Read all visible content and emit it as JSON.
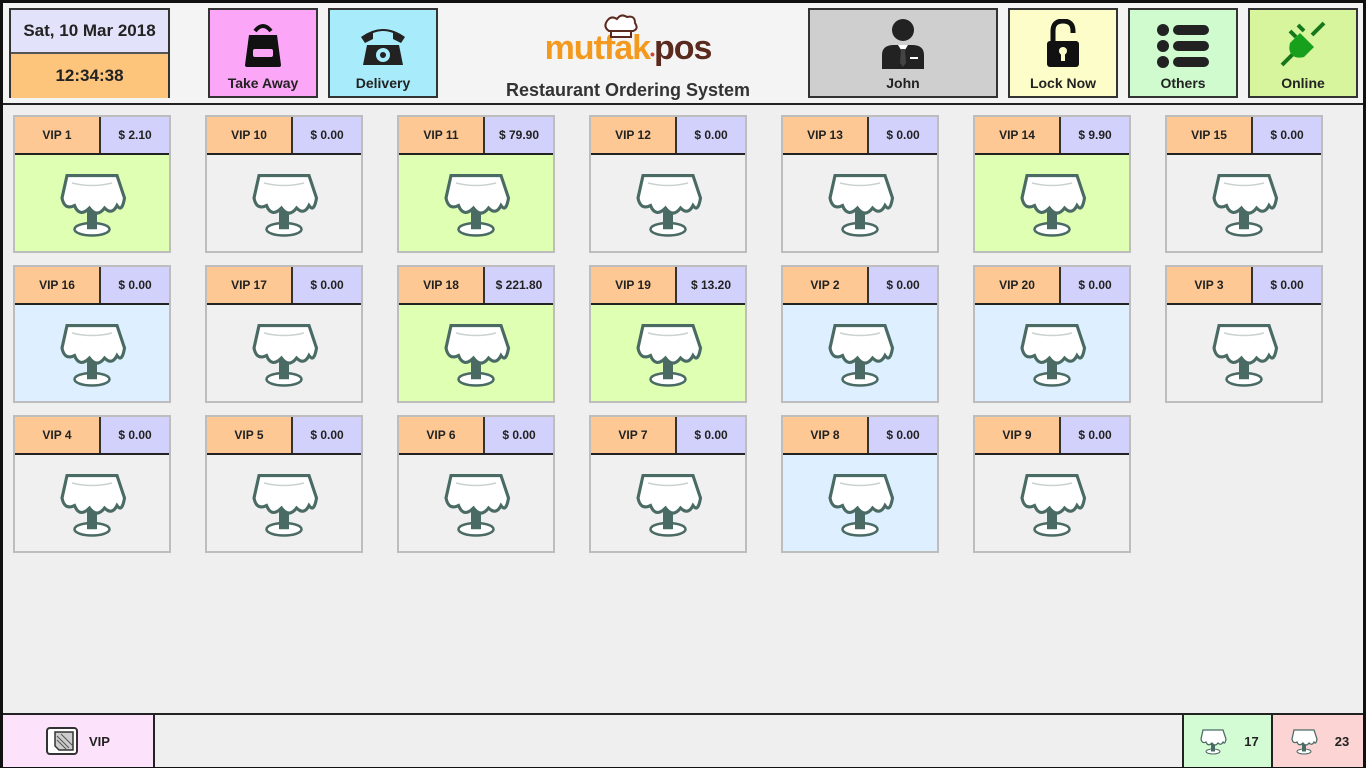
{
  "header": {
    "date": "Sat, 10 Mar 2018",
    "time": "12:34:38",
    "take_away_label": "Take Away",
    "delivery_label": "Delivery",
    "logo_part1": "mutfak",
    "logo_part2": "pos",
    "subtitle": "Restaurant Ordering System",
    "user_label": "John",
    "lock_label": "Lock Now",
    "others_label": "Others",
    "online_label": "Online",
    "colors": {
      "take_away": "#fca6f7",
      "delivery": "#a8ecfb",
      "user": "#cfcfcf",
      "lock": "#fdfdc9",
      "others": "#cffbcf",
      "online": "#d6f59c"
    }
  },
  "tables": [
    {
      "name": "VIP 1",
      "price": "$ 2.10",
      "status": "occupied"
    },
    {
      "name": "VIP 10",
      "price": "$ 0.00",
      "status": "empty"
    },
    {
      "name": "VIP 11",
      "price": "$ 79.90",
      "status": "occupied"
    },
    {
      "name": "VIP 12",
      "price": "$ 0.00",
      "status": "empty"
    },
    {
      "name": "VIP 13",
      "price": "$ 0.00",
      "status": "empty"
    },
    {
      "name": "VIP 14",
      "price": "$ 9.90",
      "status": "occupied"
    },
    {
      "name": "VIP 15",
      "price": "$ 0.00",
      "status": "empty"
    },
    {
      "name": "VIP 16",
      "price": "$ 0.00",
      "status": "reserved"
    },
    {
      "name": "VIP 17",
      "price": "$ 0.00",
      "status": "empty"
    },
    {
      "name": "VIP 18",
      "price": "$ 221.80",
      "status": "occupied"
    },
    {
      "name": "VIP 19",
      "price": "$ 13.20",
      "status": "occupied"
    },
    {
      "name": "VIP 2",
      "price": "$ 0.00",
      "status": "reserved"
    },
    {
      "name": "VIP 20",
      "price": "$ 0.00",
      "status": "reserved"
    },
    {
      "name": "VIP 3",
      "price": "$ 0.00",
      "status": "empty"
    },
    {
      "name": "VIP 4",
      "price": "$ 0.00",
      "status": "empty"
    },
    {
      "name": "VIP 5",
      "price": "$ 0.00",
      "status": "empty"
    },
    {
      "name": "VIP 6",
      "price": "$ 0.00",
      "status": "empty"
    },
    {
      "name": "VIP 7",
      "price": "$ 0.00",
      "status": "empty"
    },
    {
      "name": "VIP 8",
      "price": "$ 0.00",
      "status": "reserved"
    },
    {
      "name": "VIP 9",
      "price": "$ 0.00",
      "status": "empty"
    }
  ],
  "status_colors": {
    "occupied": "#dfffb3",
    "reserved": "#deefff",
    "empty": "#f0f0f0"
  },
  "footer": {
    "section_label": "VIP",
    "free_count": "17",
    "busy_count": "23",
    "colors": {
      "section": "#fde2fb",
      "free": "#d4fcd4",
      "busy": "#fcd4d4"
    }
  }
}
